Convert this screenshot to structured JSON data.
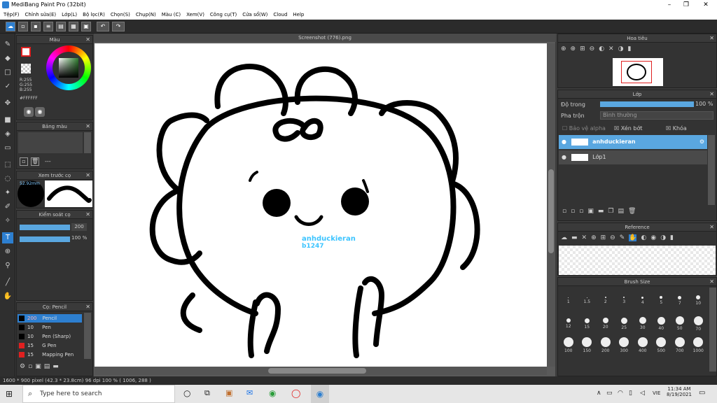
{
  "window": {
    "title": "MediBang Paint Pro (32bit)",
    "minimize": "–",
    "maximize": "❐",
    "close": "✕"
  },
  "menu": [
    "Tệp(F)",
    "Chỉnh sửa(E)",
    "Lớp(L)",
    "Bộ lọc(R)",
    "Chọn(S)",
    "Chụp(N)",
    "Màu (C)",
    "Xem(V)",
    "Công cụ(T)",
    "Cửa sổ(W)",
    "Cloud",
    "Help"
  ],
  "document": {
    "tab": "Screenshot (776).png",
    "watermark_line1": "anhduckieran",
    "watermark_line2": "b1247"
  },
  "color_panel": {
    "title": "Màu",
    "r": "R:255",
    "g": "G:255",
    "b": "B:255",
    "hex": "#FFFFFF"
  },
  "palette_panel": {
    "title": "Bảng màu",
    "dash": "---"
  },
  "preview_panel": {
    "title": "Xem trước cọ",
    "size": "52.92mm"
  },
  "brush_control": {
    "title": "Kiểm soát cọ",
    "size": "200",
    "opacity": "100 %"
  },
  "brush_panel": {
    "title": "Cọ: Pencil",
    "items": [
      {
        "size": "200",
        "name": "Pencil",
        "color": "#000000",
        "active": true
      },
      {
        "size": "10",
        "name": "Pen",
        "color": "#000000"
      },
      {
        "size": "10",
        "name": "Pen (Sharp)",
        "color": "#000000"
      },
      {
        "size": "15",
        "name": "G Pen",
        "color": "#e02020"
      },
      {
        "size": "15",
        "name": "Mapping Pen",
        "color": "#e02020"
      }
    ]
  },
  "navigator": {
    "title": "Hoa tiêu"
  },
  "layer_panel": {
    "title": "Lớp",
    "opacity_label": "Độ trong",
    "opacity_value": "100 %",
    "blend_label": "Pha trộn",
    "blend_value": "Bình thường",
    "protect_alpha": "Bảo vệ alpha",
    "clipping": "Xén bớt",
    "lock": "Khóa",
    "layers": [
      {
        "name": "anhduckieran",
        "active": true
      },
      {
        "name": "Lớp1",
        "active": false
      }
    ]
  },
  "reference_panel": {
    "title": "Reference"
  },
  "brush_size_panel": {
    "title": "Brush Size",
    "row1": [
      "1",
      "1.5",
      "2",
      "3",
      "4",
      "5",
      "7",
      "10"
    ],
    "row2": [
      "12",
      "15",
      "20",
      "25",
      "30",
      "40",
      "50",
      "70"
    ],
    "row3": [
      "100",
      "150",
      "200",
      "300",
      "400",
      "500",
      "700",
      "1000"
    ]
  },
  "status": {
    "text": "1600 * 900 pixel   (42.3 * 23.8cm)   96 dpi   100 %   ( 1006, 288 )"
  },
  "taskbar": {
    "search_placeholder": "Type here to search",
    "time": "11:34 AM",
    "date": "8/19/2021",
    "lang": "VIE"
  }
}
